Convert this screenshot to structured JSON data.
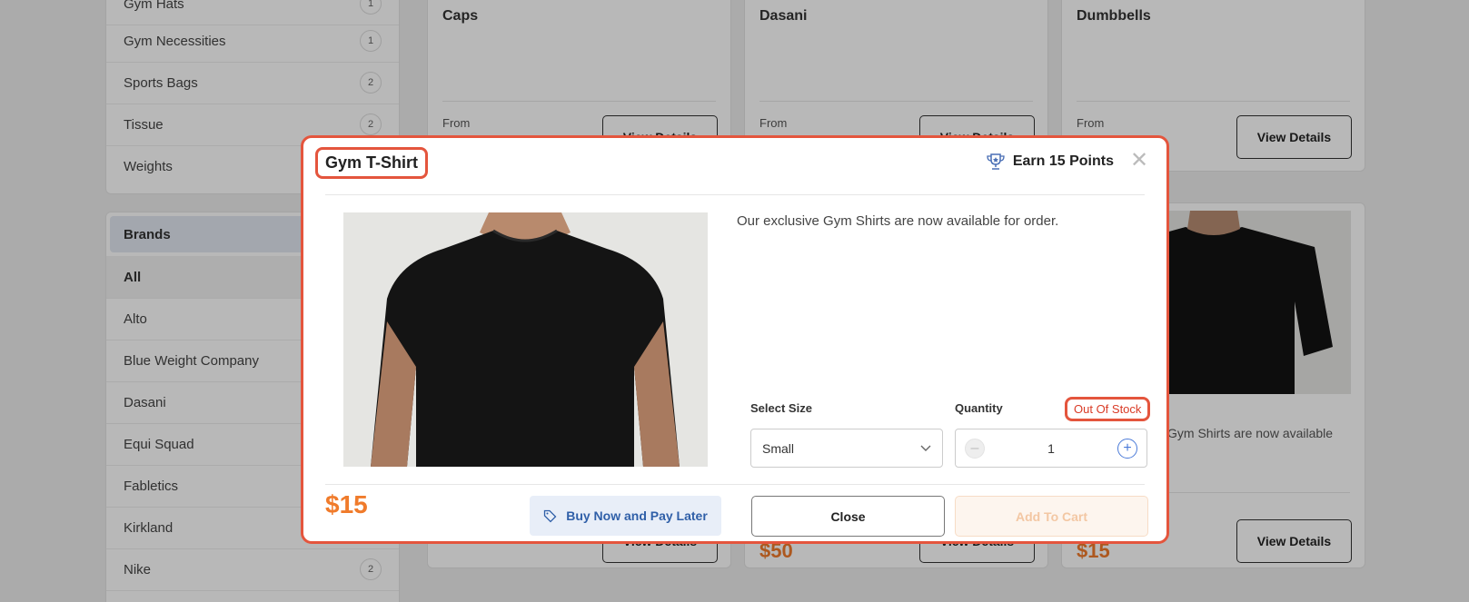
{
  "categories": [
    {
      "label": "Gym Hats",
      "count": "1"
    },
    {
      "label": "Gym Necessities",
      "count": "1"
    },
    {
      "label": "Sports Bags",
      "count": "2"
    },
    {
      "label": "Tissue",
      "count": "2"
    },
    {
      "label": "Weights",
      "count": ""
    }
  ],
  "brands": {
    "heading": "Brands",
    "items": [
      {
        "label": "All",
        "count": ""
      },
      {
        "label": "Alto",
        "count": ""
      },
      {
        "label": "Blue Weight Company",
        "count": ""
      },
      {
        "label": "Dasani",
        "count": ""
      },
      {
        "label": "Equi Squad",
        "count": ""
      },
      {
        "label": "Fabletics",
        "count": ""
      },
      {
        "label": "Kirkland",
        "count": ""
      },
      {
        "label": "Nike",
        "count": "2"
      }
    ]
  },
  "products": [
    {
      "title": "Caps",
      "from": "From",
      "button": "View Details"
    },
    {
      "title": "Dasani",
      "from": "From",
      "button": "View Details"
    },
    {
      "title": "Dumbbells",
      "from": "From",
      "button": "View Details"
    }
  ],
  "products_row2": {
    "desc": "Gym Shirts are now available",
    "button": "View Details",
    "prices": [
      "$50",
      "$15"
    ]
  },
  "modal": {
    "title": "Gym T-Shirt",
    "earn_points": "Earn 15 Points",
    "description": "Our exclusive Gym Shirts are now available for order.",
    "size_label": "Select Size",
    "size_value": "Small",
    "quantity_label": "Quantity",
    "quantity_value": "1",
    "stock_status": "Out Of Stock",
    "price": "$15",
    "bnpl_label": "Buy Now and Pay Later",
    "close_label": "Close",
    "add_to_cart_label": "Add To Cart"
  },
  "colors": {
    "accent": "#e4553d",
    "price": "#f07b2b",
    "link_blue": "#2f5fa8"
  }
}
